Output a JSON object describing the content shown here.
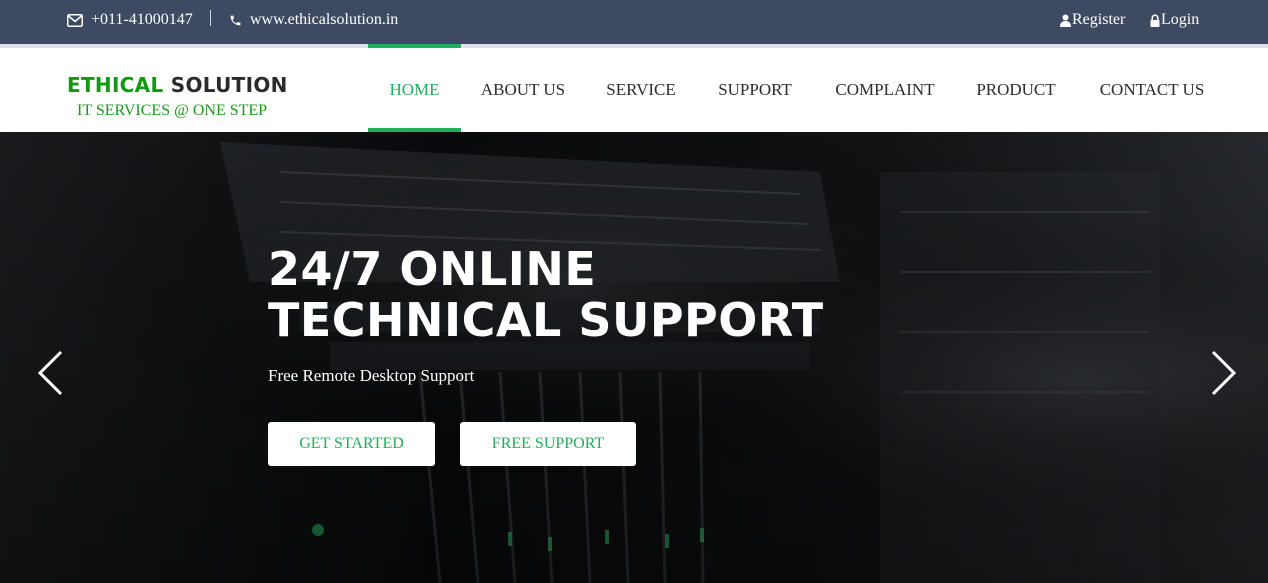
{
  "topbar": {
    "phone": "+011-41000147",
    "website": "www.ethicalsolution.in",
    "register_label": "Register",
    "login_label": "Login",
    "icons": [
      "envelope-icon",
      "phone-icon",
      "user-icon",
      "lock-icon"
    ]
  },
  "logo": {
    "part1": "ETHICAL",
    "part2": "SOLUTION",
    "tagline": "IT SERVICES @ ONE STEP"
  },
  "nav": {
    "items": [
      "HOME",
      "ABOUT US",
      "SERVICE",
      "SUPPORT",
      "COMPLAINT",
      "PRODUCT",
      "CONTACT US"
    ],
    "active": "HOME"
  },
  "hero": {
    "title_line1": "24/7 ONLINE",
    "title_line2": "TECHNICAL SUPPORT",
    "subtitle": "Free Remote Desktop Support",
    "button_primary": "GET STARTED",
    "button_secondary": "FREE SUPPORT",
    "icons": [
      "chevron-left-icon",
      "chevron-right-icon"
    ]
  },
  "colors": {
    "topbar_bg": "#3e4a62",
    "accent_green": "#1fae5a",
    "logo_green": "#129912"
  }
}
